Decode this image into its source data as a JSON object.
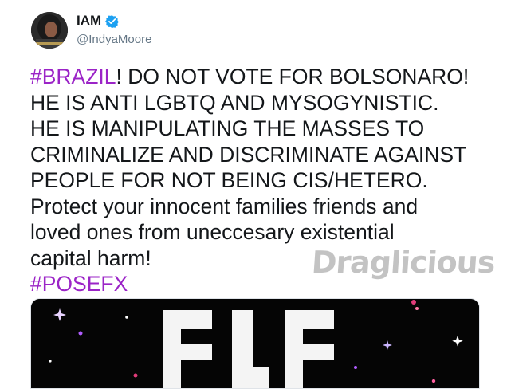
{
  "tweet": {
    "display_name": "IAM",
    "handle": "@IndyaMoore",
    "lines": [
      {
        "hashtag": "#BRAZIL",
        "text": "! DO NOT VOTE FOR BOLSONARO!"
      },
      {
        "hashtag": "",
        "text": "HE IS ANTI LGBTQ AND MYSOGYNISTIC."
      },
      {
        "hashtag": "",
        "text": "HE IS MANIPULATING THE MASSES TO"
      },
      {
        "hashtag": "",
        "text": "CRIMINALIZE AND DISCRIMINATE AGAINST"
      },
      {
        "hashtag": "",
        "text": "PEOPLE FOR NOT BEING CIS/HETERO."
      },
      {
        "hashtag": "",
        "text": "Protect your innocent families friends and"
      },
      {
        "hashtag": "",
        "text": "loved ones from uneccesary existential"
      },
      {
        "hashtag": "",
        "text": "capital harm!"
      },
      {
        "hashtag": "#POSEFX",
        "text": ""
      }
    ]
  },
  "watermark": "Draglicious",
  "colors": {
    "hashtag": "#9b24c7",
    "text": "#14171a",
    "handle": "#657786",
    "verified": "#1da1f2",
    "media_bg": "#050505"
  },
  "icons": {
    "verified": "verified-badge-icon"
  }
}
